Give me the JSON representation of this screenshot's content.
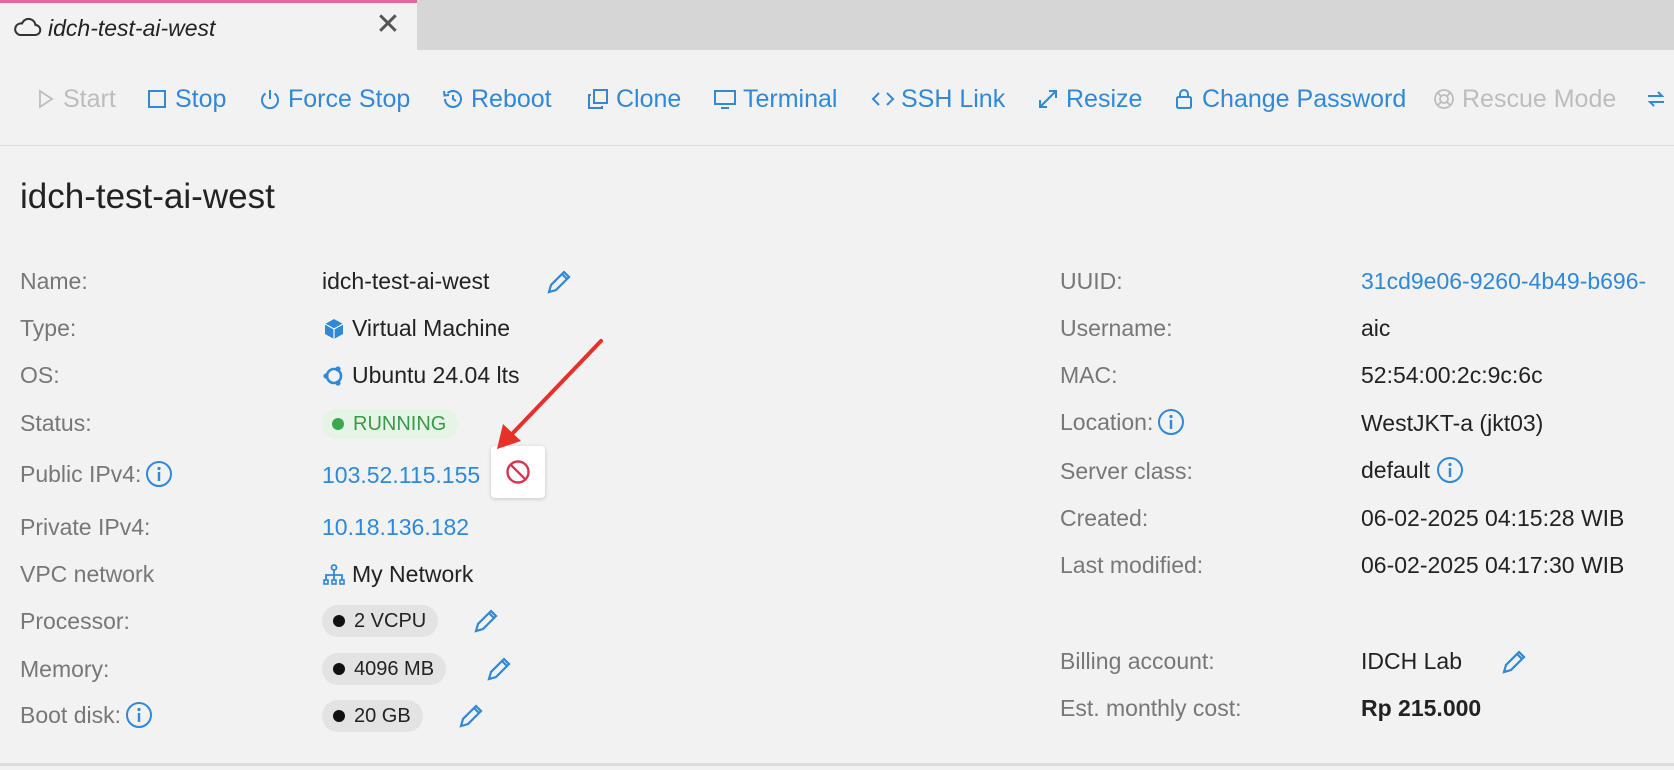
{
  "tab": {
    "title": "idch-test-ai-west",
    "close": "✕"
  },
  "toolbar": {
    "start": "Start",
    "stop": "Stop",
    "force_stop": "Force Stop",
    "reboot": "Reboot",
    "clone": "Clone",
    "terminal": "Terminal",
    "ssh_link": "SSH Link",
    "resize": "Resize",
    "change_password": "Change Password",
    "rescue_mode": "Rescue Mode"
  },
  "page_title": "idch-test-ai-west",
  "left": {
    "name_label": "Name:",
    "name": "idch-test-ai-west",
    "type_label": "Type:",
    "type": "Virtual Machine",
    "os_label": "OS:",
    "os": "Ubuntu 24.04 lts",
    "status_label": "Status:",
    "status": "RUNNING",
    "public_ipv4_label": "Public IPv4:",
    "public_ipv4": "103.52.115.155",
    "private_ipv4_label": "Private IPv4:",
    "private_ipv4": "10.18.136.182",
    "vpc_label": "VPC network",
    "vpc": "My Network",
    "processor_label": "Processor:",
    "processor": "2 VCPU",
    "memory_label": "Memory:",
    "memory": "4096 MB",
    "boot_disk_label": "Boot disk:",
    "boot_disk": "20 GB"
  },
  "right": {
    "uuid_label": "UUID:",
    "uuid": "31cd9e06-9260-4b49-b696-",
    "username_label": "Username:",
    "username": "aic",
    "mac_label": "MAC:",
    "mac": "52:54:00:2c:9c:6c",
    "location_label": "Location:",
    "location": "WestJKT-a (jkt03)",
    "server_class_label": "Server class:",
    "server_class": "default",
    "created_label": "Created:",
    "created": "06-02-2025 04:15:28 WIB",
    "last_modified_label": "Last modified:",
    "last_modified": "06-02-2025 04:17:30 WIB",
    "billing_label": "Billing account:",
    "billing": "IDCH Lab",
    "cost_label": "Est. monthly cost:",
    "cost": "Rp 215.000"
  },
  "colors": {
    "accent": "#2f88d8",
    "running_green": "#3aa84d",
    "danger": "#d9344f",
    "annotation_arrow": "#e8302a",
    "tab_indicator": "#e06a9c"
  }
}
